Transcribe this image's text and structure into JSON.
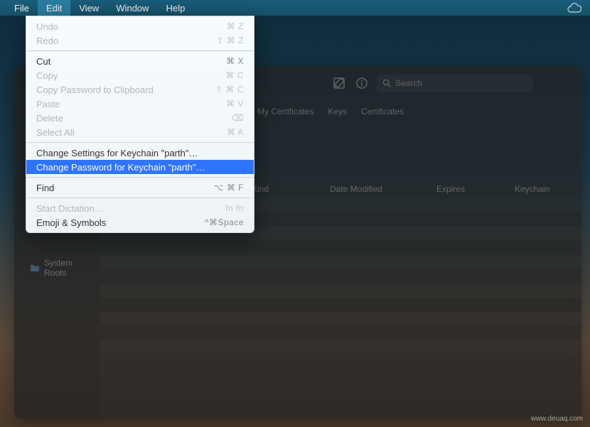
{
  "menubar": {
    "items": [
      "File",
      "Edit",
      "View",
      "Window",
      "Help"
    ],
    "active_index": 1
  },
  "dropdown": {
    "items": [
      {
        "label": "Undo",
        "shortcut": "⌘ Z",
        "enabled": false
      },
      {
        "label": "Redo",
        "shortcut": "⇧ ⌘ Z",
        "enabled": false
      },
      {
        "sep": true
      },
      {
        "label": "Cut",
        "shortcut": "⌘ X",
        "enabled": true
      },
      {
        "label": "Copy",
        "shortcut": "⌘ C",
        "enabled": false
      },
      {
        "label": "Copy Password to Clipboard",
        "shortcut": "⇧ ⌘ C",
        "enabled": false
      },
      {
        "label": "Paste",
        "shortcut": "⌘ V",
        "enabled": false
      },
      {
        "label": "Delete",
        "shortcut": "⌫",
        "enabled": false
      },
      {
        "label": "Select All",
        "shortcut": "⌘ A",
        "enabled": false
      },
      {
        "sep": true
      },
      {
        "label": "Change Settings for Keychain \"parth\"…",
        "shortcut": "",
        "enabled": true
      },
      {
        "label": "Change Password for Keychain \"parth\"…",
        "shortcut": "",
        "enabled": true,
        "highlight": true
      },
      {
        "sep": true
      },
      {
        "label": "Find",
        "shortcut": "⌥ ⌘ F",
        "enabled": true
      },
      {
        "sep": true
      },
      {
        "label": "Start Dictation…",
        "shortcut": "fn fn",
        "enabled": false
      },
      {
        "label": "Emoji & Symbols",
        "shortcut": "^⌘Space",
        "enabled": true
      }
    ]
  },
  "toolbar": {
    "search_placeholder": "Search"
  },
  "tabs": [
    "My Certificates",
    "Keys",
    "Certificates"
  ],
  "columns": {
    "name": "",
    "kind": "Kind",
    "modified": "Date Modified",
    "expires": "Expires",
    "keychain": "Keychain"
  },
  "sidebar": {
    "items": [
      {
        "label": "System Roots",
        "icon": "folder"
      }
    ]
  },
  "watermark": "www.deuaq.com"
}
